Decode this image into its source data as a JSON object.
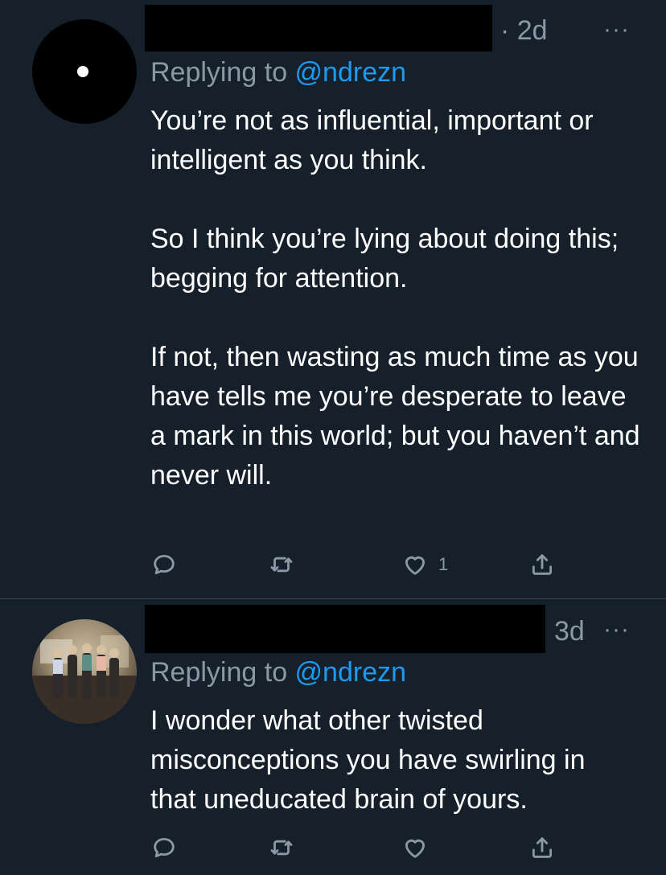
{
  "tweets": [
    {
      "time": "· 2d",
      "more": "···",
      "replying_prefix": "Replying to ",
      "replying_handle": "@ndrezn",
      "paragraphs": [
        "You’re not as influential, important or intelligent as you think.",
        "So I think you’re lying about doing this; begging for attention.",
        "If not, then wasting as much time as you have tells me you’re desperate to leave a mark in this world; but you haven’t and never will."
      ],
      "like_count": "1"
    },
    {
      "time": "3d",
      "more": "···",
      "replying_prefix": "Replying to ",
      "replying_handle": "@ndrezn",
      "paragraphs": [
        "I wonder what other twisted misconceptions you have swirling in that uneducated brain of yours."
      ],
      "like_count": ""
    }
  ],
  "icons": {
    "reply": "reply-icon",
    "retweet": "retweet-icon",
    "like": "heart-icon",
    "share": "share-icon",
    "more": "more-options-icon"
  },
  "colors": {
    "background": "#15202b",
    "secondary_text": "#8b98a5",
    "link": "#1d9bf0",
    "divider": "#38444d"
  }
}
